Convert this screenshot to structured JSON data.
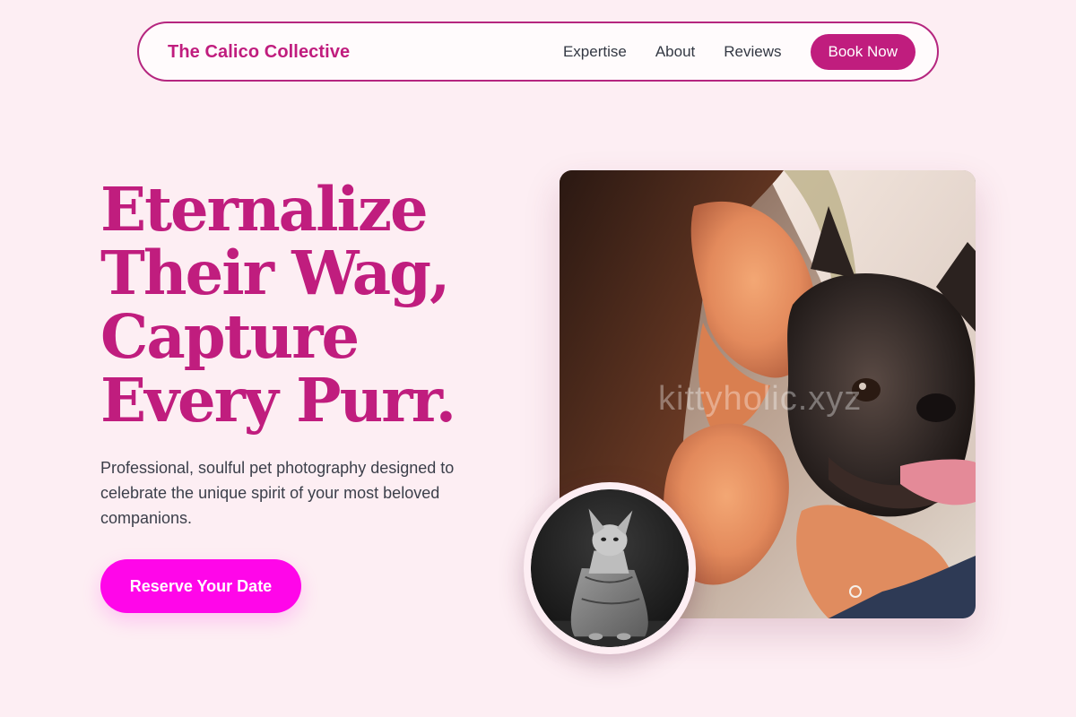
{
  "nav": {
    "brand": "The Calico Collective",
    "links": [
      "Expertise",
      "About",
      "Reviews"
    ],
    "cta": "Book Now"
  },
  "hero": {
    "headline_lines": [
      "Eternalize",
      "Their Wag,",
      "Capture",
      "Every Purr."
    ],
    "subtext": "Professional, soulful pet photography designed to celebrate the unique spirit of your most beloved companions.",
    "cta": "Reserve Your Date",
    "photo_watermark": "kittyholic.xyz"
  },
  "colors": {
    "background": "#fdeef3",
    "brand": "#c01d7e",
    "cta": "#ff06e9",
    "text": "#3b3f4a"
  }
}
